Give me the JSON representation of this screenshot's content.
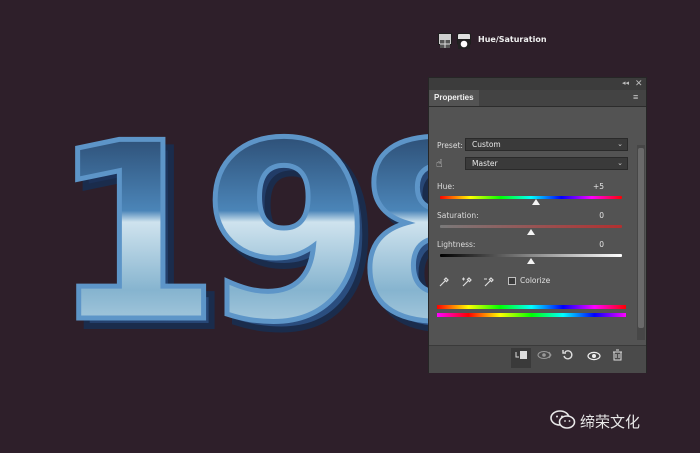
{
  "canvas": {
    "background": "#2e1f2a",
    "artwork_text": "198"
  },
  "panel": {
    "title_tab": "Properties",
    "adjustment_title": "Hue/Saturation",
    "preset_label": "Preset:",
    "preset_value": "Custom",
    "channel_value": "Master",
    "hue_label": "Hue:",
    "hue_value": "+5",
    "saturation_label": "Saturation:",
    "saturation_value": "0",
    "lightness_label": "Lightness:",
    "lightness_value": "0",
    "colorize_label": "Colorize",
    "colorize_checked": false
  },
  "icons": {
    "collapse": "collapse-panel-icon",
    "close": "close-icon",
    "menu": "panel-menu-icon",
    "hand": "targeted-adjustment-hand-icon",
    "eyedroppers": [
      "eyedropper-icon",
      "eyedropper-plus-icon",
      "eyedropper-minus-icon"
    ],
    "bottom": [
      "clip-to-layer-icon",
      "view-previous-state-icon",
      "reset-icon",
      "visibility-eye-icon",
      "trash-icon"
    ]
  },
  "watermark": {
    "text": "缔荣文化"
  }
}
